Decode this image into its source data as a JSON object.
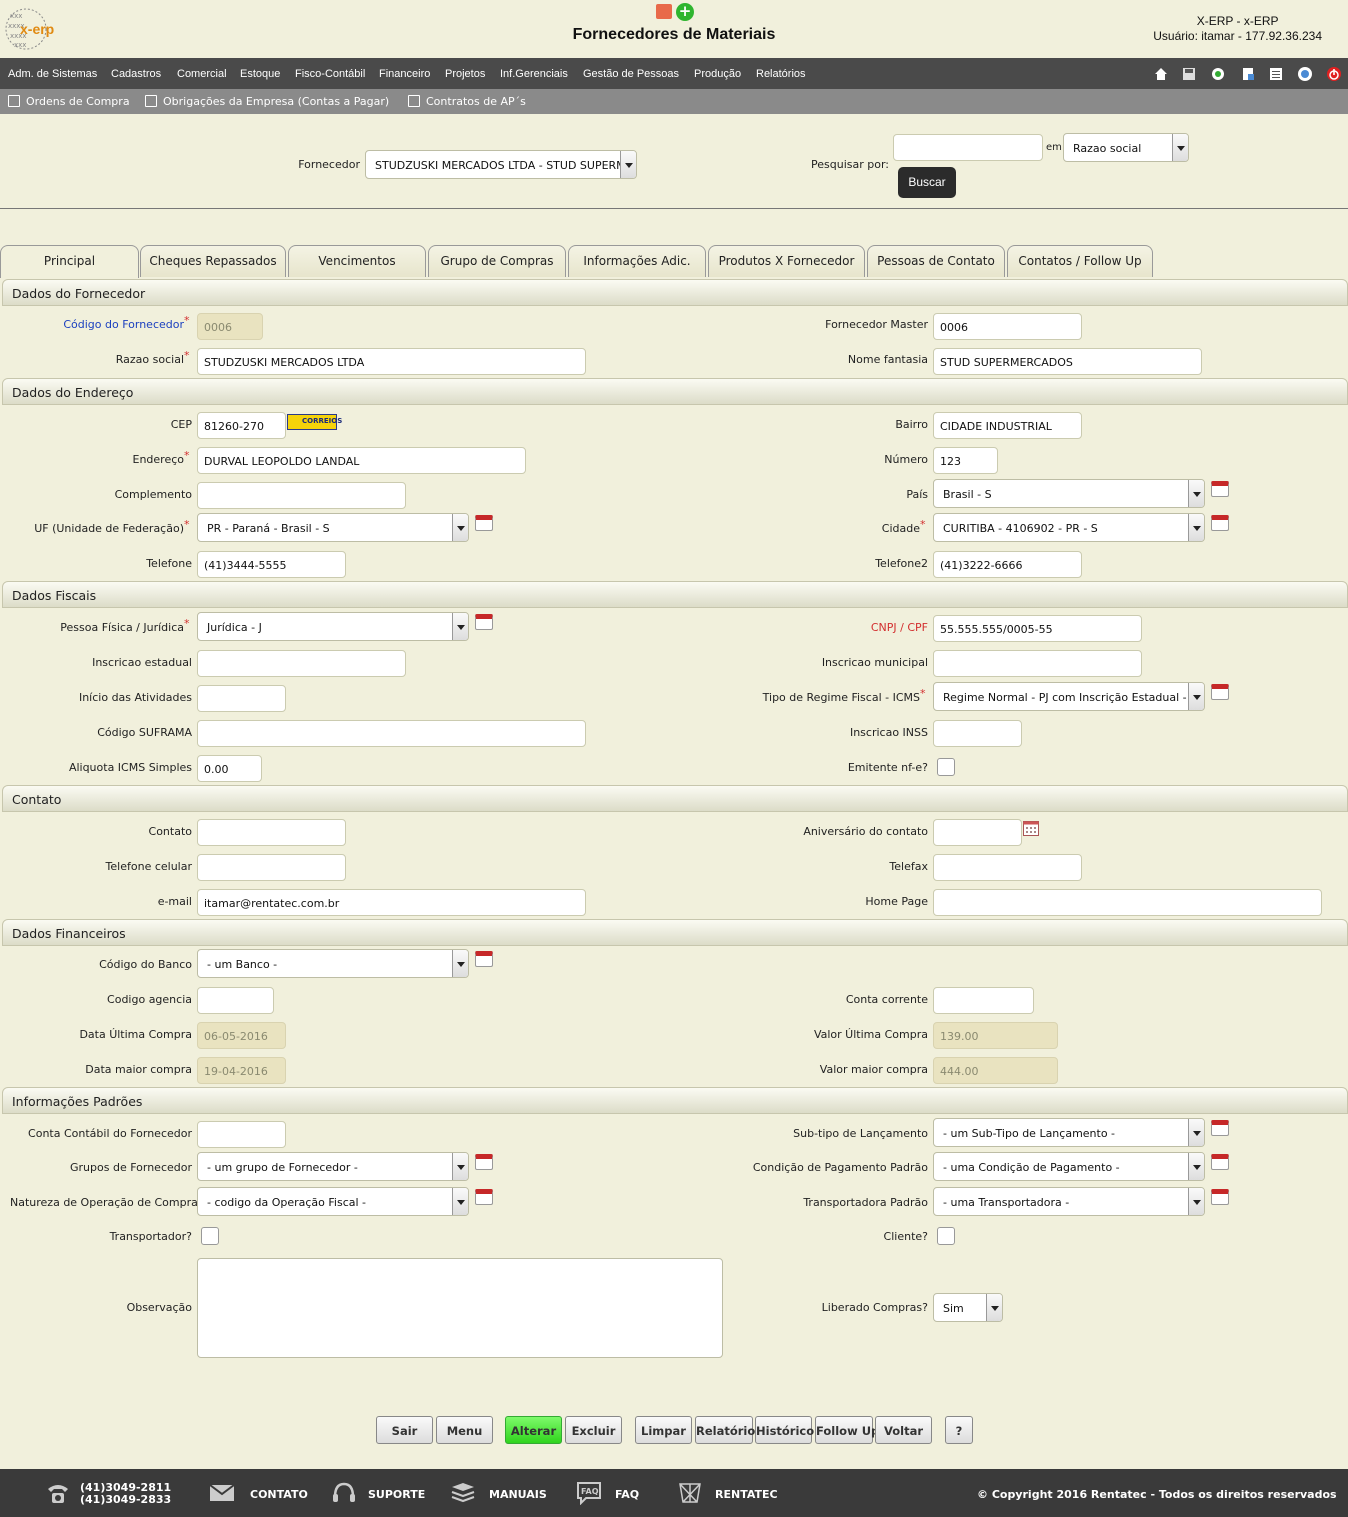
{
  "header": {
    "logo_text": "x-erp",
    "title": "Fornecedores de Materiais",
    "user_line1": "X-ERP - x-ERP",
    "user_line2": "Usuário: itamar - 177.92.36.234"
  },
  "menu": [
    "Adm. de Sistemas",
    "Cadastros",
    "Comercial",
    "Estoque",
    "Fisco-Contábil",
    "Financeiro",
    "Projetos",
    "Inf.Gerenciais",
    "Gestão de Pessoas",
    "Produção",
    "Relatórios"
  ],
  "toolbar_icons": [
    "home-icon",
    "save-icon",
    "recycle-icon",
    "document-icon",
    "list-icon",
    "help-icon",
    "power-icon"
  ],
  "subnav": [
    "Ordens de Compra",
    "Obrigações da Empresa (Contas a Pagar)",
    "Contratos de AP´s"
  ],
  "search": {
    "fornecedor_label": "Fornecedor",
    "fornecedor_value": "STUDZUSKI MERCADOS LTDA - STUD SUPERMEI",
    "pesquisar_label": "Pesquisar por:",
    "pesquisar_value": "",
    "em_label": "em",
    "em_value": "Razao social",
    "buscar": "Buscar"
  },
  "tabs": [
    "Principal",
    "Cheques Repassados",
    "Vencimentos",
    "Grupo de Compras",
    "Informações Adic.",
    "Produtos X Fornecedor",
    "Pessoas de Contato",
    "Contatos / Follow Up"
  ],
  "sections": {
    "fornecedor": "Dados do Fornecedor",
    "endereco": "Dados do Endereço",
    "fiscais": "Dados Fiscais",
    "contato": "Contato",
    "financeiros": "Dados Financeiros",
    "padroes": "Informações Padrões"
  },
  "fields": {
    "codigo_label": "Código do Fornecedor",
    "codigo": "0006",
    "master_label": "Fornecedor Master",
    "master": "0006",
    "razao_label": "Razao social",
    "razao": "STUDZUSKI MERCADOS LTDA",
    "fantasia_label": "Nome fantasia",
    "fantasia": "STUD SUPERMERCADOS",
    "cep_label": "CEP",
    "cep": "81260-270",
    "correios": "CORREIOS",
    "bairro_label": "Bairro",
    "bairro": "CIDADE INDUSTRIAL",
    "endereco_label": "Endereço",
    "endereco": "DURVAL LEOPOLDO LANDAL",
    "numero_label": "Número",
    "numero": "123",
    "complemento_label": "Complemento",
    "complemento": "",
    "pais_label": "País",
    "pais": "Brasil - S",
    "uf_label": "UF (Unidade de Federação)",
    "uf": "PR - Paraná - Brasil - S",
    "cidade_label": "Cidade",
    "cidade": "CURITIBA - 4106902 - PR - S",
    "telefone_label": "Telefone",
    "telefone": "(41)3444-5555",
    "telefone2_label": "Telefone2",
    "telefone2": "(41)3222-6666",
    "pessoa_label": "Pessoa Física / Jurídica",
    "pessoa": "Jurídica - J",
    "cnpj_label": "CNPJ / CPF",
    "cnpj": "55.555.555/0005-55",
    "ie_label": "Inscricao estadual",
    "ie": "",
    "im_label": "Inscricao municipal",
    "im": "",
    "inicio_label": "Início das Atividades",
    "inicio": "",
    "regime_label": "Tipo de Regime Fiscal - ICMS",
    "regime": "Regime Normal - PJ com Inscrição Estadual - Não",
    "suframa_label": "Código SUFRAMA",
    "suframa": "",
    "inss_label": "Inscricao INSS",
    "inss": "",
    "aliquota_label": "Aliquota ICMS Simples",
    "aliquota": "0.00",
    "nfe_label": "Emitente nf-e?",
    "contato_label": "Contato",
    "contato": "",
    "aniversario_label": "Aniversário do contato",
    "aniversario": "",
    "celular_label": "Telefone celular",
    "celular": "",
    "telefax_label": "Telefax",
    "telefax": "",
    "email_label": "e-mail",
    "email": "itamar@rentatec.com.br",
    "homepage_label": "Home Page",
    "homepage": "",
    "banco_label": "Código do Banco",
    "banco": "- um Banco -",
    "agencia_label": "Codigo agencia",
    "agencia": "",
    "conta_label": "Conta corrente",
    "conta": "",
    "data_ultima_label": "Data Última Compra",
    "data_ultima": "06-05-2016",
    "valor_ultima_label": "Valor Última Compra",
    "valor_ultima": "139.00",
    "data_maior_label": "Data maior compra",
    "data_maior": "19-04-2016",
    "valor_maior_label": "Valor maior compra",
    "valor_maior": "444.00",
    "conta_contabil_label": "Conta Contábil do Fornecedor",
    "conta_contabil": "",
    "subtipo_label": "Sub-tipo de Lançamento",
    "subtipo": "- um Sub-Tipo de Lançamento -",
    "grupos_label": "Grupos de Fornecedor",
    "grupos": "- um grupo de Fornecedor -",
    "condicao_label": "Condição de Pagamento Padrão",
    "condicao": "- uma Condição de Pagamento -",
    "natureza_label": "Natureza de Operação de Compra",
    "natureza": "- codigo da Operação Fiscal -",
    "transportadora_label": "Transportadora Padrão",
    "transportadora": "- uma Transportadora -",
    "transportador_label": "Transportador?",
    "cliente_label": "Cliente?",
    "observacao_label": "Observação",
    "observacao": "",
    "liberado_label": "Liberado Compras?",
    "liberado": "Sim"
  },
  "buttons": [
    "Sair",
    "Menu",
    "Alterar",
    "Excluir",
    "Limpar",
    "Relatório",
    "Histórico",
    "Follow Up",
    "Voltar",
    "?"
  ],
  "footer": {
    "phone1": "(41)3049-2811",
    "phone2": "(41)3049-2833",
    "contato": "CONTATO",
    "suporte": "SUPORTE",
    "manuais": "MANUAIS",
    "faq": "FAQ",
    "rentatec": "RENTATEC",
    "copyright": "© Copyright 2016 Rentatec - Todos os direitos reservados"
  },
  "colors": {
    "menubar": "#4a4a4a",
    "subbar": "#8a8a8a",
    "background": "#f1f0dc",
    "accent_green": "#2fd41d",
    "required": "#d32f2f",
    "footer": "#3a3a3a"
  }
}
